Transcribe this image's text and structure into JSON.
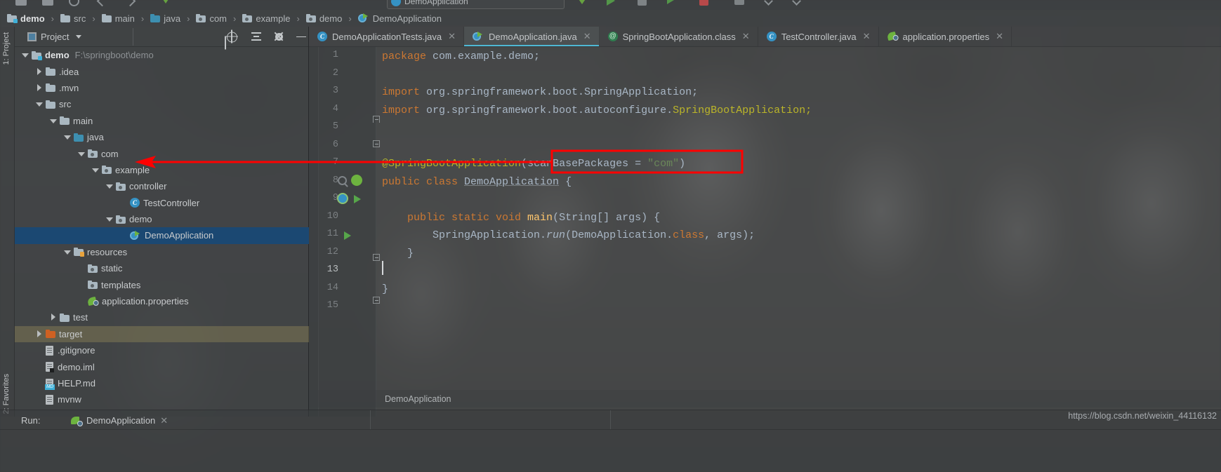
{
  "window": {
    "toolbar_combo": "DemoApplication"
  },
  "breadcrumb": {
    "separator": "›",
    "items": [
      {
        "label": "demo",
        "icon": "folder-module-icon"
      },
      {
        "label": "src",
        "icon": "folder-icon"
      },
      {
        "label": "main",
        "icon": "folder-icon"
      },
      {
        "label": "java",
        "icon": "folder-source-icon"
      },
      {
        "label": "com",
        "icon": "folder-package-icon"
      },
      {
        "label": "example",
        "icon": "folder-package-icon"
      },
      {
        "label": "demo",
        "icon": "folder-package-icon"
      },
      {
        "label": "DemoApplication",
        "icon": "spring-boot-class-icon"
      }
    ]
  },
  "left_strip": {
    "project_label": "1: Project",
    "favorites_label": "2: Favorites"
  },
  "project_panel": {
    "title": "Project",
    "buttons": [
      {
        "name": "select-opened-file",
        "label": "locate-icon"
      },
      {
        "name": "collapse-all",
        "label": "collapse-all-icon"
      },
      {
        "name": "settings",
        "label": "gear-icon"
      },
      {
        "name": "hide",
        "label": "minimize-icon"
      }
    ],
    "tree": [
      {
        "label": "demo",
        "path": "F:\\springboot\\demo",
        "indent": 0,
        "twist": "down",
        "icon": "folder-module-icon",
        "bold": true
      },
      {
        "label": ".idea",
        "indent": 1,
        "twist": "right",
        "icon": "folder-icon"
      },
      {
        "label": ".mvn",
        "indent": 1,
        "twist": "right",
        "icon": "folder-icon"
      },
      {
        "label": "src",
        "indent": 1,
        "twist": "down",
        "icon": "folder-icon"
      },
      {
        "label": "main",
        "indent": 2,
        "twist": "down",
        "icon": "folder-icon"
      },
      {
        "label": "java",
        "indent": 3,
        "twist": "down",
        "icon": "folder-source-icon"
      },
      {
        "label": "com",
        "indent": 4,
        "twist": "down",
        "icon": "folder-package-icon"
      },
      {
        "label": "example",
        "indent": 5,
        "twist": "down",
        "icon": "folder-package-icon"
      },
      {
        "label": "controller",
        "indent": 6,
        "twist": "down",
        "icon": "folder-package-icon"
      },
      {
        "label": "TestController",
        "indent": 7,
        "twist": "none",
        "icon": "java-class-icon"
      },
      {
        "label": "demo",
        "indent": 6,
        "twist": "down",
        "icon": "folder-package-icon"
      },
      {
        "label": "DemoApplication",
        "indent": 7,
        "twist": "none",
        "icon": "spring-boot-class-icon",
        "selected": true
      },
      {
        "label": "resources",
        "indent": 3,
        "twist": "down",
        "icon": "folder-resources-icon"
      },
      {
        "label": "static",
        "indent": 4,
        "twist": "none",
        "icon": "folder-package-icon"
      },
      {
        "label": "templates",
        "indent": 4,
        "twist": "none",
        "icon": "folder-package-icon"
      },
      {
        "label": "application.properties",
        "indent": 4,
        "twist": "none",
        "icon": "spring-leaf-icon"
      },
      {
        "label": "test",
        "indent": 2,
        "twist": "right",
        "icon": "folder-icon"
      },
      {
        "label": "target",
        "indent": 1,
        "twist": "right",
        "icon": "folder-excluded-icon",
        "highlighted": true
      },
      {
        "label": ".gitignore",
        "indent": 1,
        "twist": "none",
        "icon": "file-icon"
      },
      {
        "label": "demo.iml",
        "indent": 1,
        "twist": "none",
        "icon": "iml-file-icon"
      },
      {
        "label": "HELP.md",
        "indent": 1,
        "twist": "none",
        "icon": "markdown-file-icon"
      },
      {
        "label": "mvnw",
        "indent": 1,
        "twist": "none",
        "icon": "file-icon"
      }
    ]
  },
  "editor": {
    "tabs": [
      {
        "label": "DemoApplicationTests.java",
        "icon": "java-test-class-icon",
        "active": false,
        "close": "✕"
      },
      {
        "label": "DemoApplication.java",
        "icon": "spring-boot-class-icon",
        "active": true,
        "close": "✕"
      },
      {
        "label": "SpringBootApplication.class",
        "icon": "annotation-icon",
        "active": false,
        "close": "✕"
      },
      {
        "label": "TestController.java",
        "icon": "java-class-icon",
        "active": false,
        "close": "✕"
      },
      {
        "label": "application.properties",
        "icon": "spring-leaf-icon",
        "active": false,
        "close": "✕"
      }
    ],
    "line_numbers": [
      "1",
      "2",
      "3",
      "4",
      "5",
      "6",
      "7",
      "8",
      "9",
      "10",
      "11",
      "12",
      "13",
      "14",
      "15"
    ],
    "current_line": "13",
    "lines": [
      {
        "n": 1,
        "segments": [
          {
            "t": "package ",
            "c": "kw"
          },
          {
            "t": "com.example.demo;",
            "c": "cls"
          }
        ]
      },
      {
        "n": 2,
        "segments": []
      },
      {
        "n": 3,
        "segments": [
          {
            "t": "import ",
            "c": "kw"
          },
          {
            "t": "org.springframework.boot.SpringApplication;",
            "c": "cls"
          }
        ]
      },
      {
        "n": 4,
        "segments": [
          {
            "t": "import ",
            "c": "kw"
          },
          {
            "t": "org.springframework.boot.autoconfigure.",
            "c": "cls"
          },
          {
            "t": "SpringBootApplication;",
            "c": "ann"
          }
        ]
      },
      {
        "n": 5,
        "segments": []
      },
      {
        "n": 6,
        "segments": []
      },
      {
        "n": 7,
        "segments": [
          {
            "t": "@SpringBootApplication",
            "c": "ann"
          },
          {
            "t": "(",
            "c": "cls"
          },
          {
            "t": "scanBasePackages",
            "c": "cls"
          },
          {
            "t": " = ",
            "c": "cls"
          },
          {
            "t": "\"com\"",
            "c": "str"
          },
          {
            "t": ")",
            "c": "cls"
          }
        ]
      },
      {
        "n": 8,
        "segments": [
          {
            "t": "public class ",
            "c": "kw"
          },
          {
            "t": "DemoApplication",
            "c": "cls underline"
          },
          {
            "t": " {",
            "c": "cls"
          }
        ]
      },
      {
        "n": 9,
        "segments": []
      },
      {
        "n": 10,
        "segments": [
          {
            "t": "    public static void ",
            "c": "kw"
          },
          {
            "t": "main",
            "c": "fn"
          },
          {
            "t": "(",
            "c": "cls"
          },
          {
            "t": "String",
            "c": "cls"
          },
          {
            "t": "[] args) {",
            "c": "cls"
          }
        ]
      },
      {
        "n": 11,
        "segments": [
          {
            "t": "        SpringApplication.",
            "c": "cls"
          },
          {
            "t": "run",
            "c": "cls italic"
          },
          {
            "t": "(DemoApplication.",
            "c": "cls"
          },
          {
            "t": "class",
            "c": "kw"
          },
          {
            "t": ", args);",
            "c": "cls"
          }
        ]
      },
      {
        "n": 12,
        "segments": [
          {
            "t": "    }",
            "c": "cls"
          }
        ]
      },
      {
        "n": 13,
        "segments": []
      },
      {
        "n": 14,
        "segments": [
          {
            "t": "}",
            "c": "cls"
          }
        ]
      },
      {
        "n": 15,
        "segments": []
      }
    ],
    "status_breadcrumb": "DemoApplication"
  },
  "run_panel": {
    "label": "Run:",
    "tab_label": "DemoApplication",
    "tab_icon": "spring-boot-run-icon",
    "tab_close": "✕"
  },
  "watermark": "https://blog.csdn.net/weixin_44116132",
  "annotation": {
    "color": "#ff0000",
    "arrow_target_label": "com",
    "highlighted_code": "(scanBasePackages = \"com\")"
  },
  "colors": {
    "accent": "#4fb8d4",
    "selection": "#1b4872",
    "annotation_red": "#ff0000",
    "keyword_orange": "#cc7832",
    "string_green": "#6a8759",
    "annotation_yellow": "#bbb529",
    "text_grey": "#a9b7c6"
  }
}
